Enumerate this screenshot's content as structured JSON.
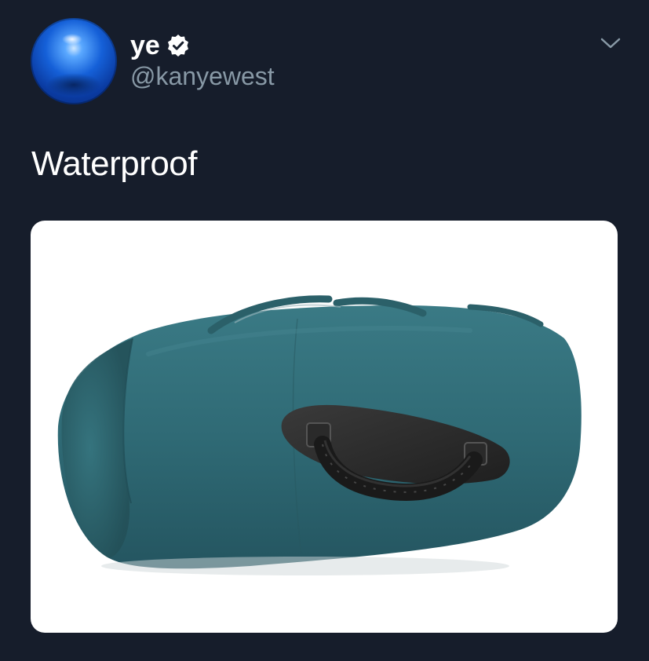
{
  "user": {
    "display_name": "ye",
    "handle": "@kanyewest",
    "verified": true,
    "avatar_icon": "blue-orb-avatar"
  },
  "tweet": {
    "text": "Waterproof"
  },
  "media": {
    "description_icon": "duffel-bag-with-handle-image"
  },
  "colors": {
    "background": "#161d2b",
    "handle": "#8899a6",
    "bag": "#2f6a75"
  }
}
